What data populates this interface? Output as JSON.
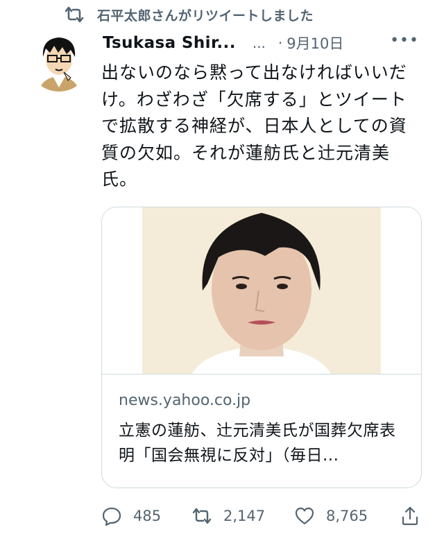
{
  "retweet": {
    "icon": "retweet-icon",
    "label": "石平太郎さんがリツイートしました"
  },
  "tweet": {
    "author": "Tsukasa Shir...",
    "handle": "...",
    "date": "9月10日",
    "more": "•••",
    "text": "出ないのなら黙って出なければいいだけ。わざわざ「欠席する」とツイートで拡散する神経が、日本人としての資質の欠如。それが蓮舫氏と辻元清美氏。"
  },
  "card": {
    "domain": "news.yahoo.co.jp",
    "title": "立憲の蓮舫、辻元清美氏が国葬欠席表明「国会無視に反対」（毎日..."
  },
  "actions": {
    "replies": "485",
    "retweets": "2,147",
    "likes": "8,765"
  },
  "colors": {
    "secondary_text": "#536471",
    "border": "#cfd9de",
    "text": "#0f1419"
  }
}
